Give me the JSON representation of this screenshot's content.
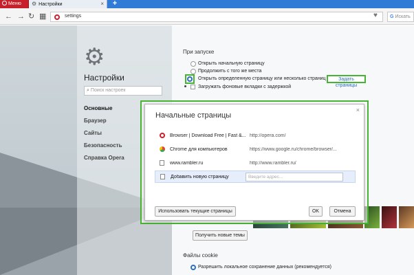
{
  "browser": {
    "menu_label": "Меню",
    "tab_title": "Настройки",
    "tab_close": "×",
    "new_tab": "+",
    "url": "settings",
    "search_engine": "G",
    "search_placeholder": "Искать",
    "nav_back": "←",
    "nav_forward": "→",
    "nav_reload": "↻",
    "grid": "▦",
    "heart": "♥"
  },
  "sidebar": {
    "title": "Настройки",
    "search_placeholder": "Поиск настроек",
    "items": [
      {
        "label": "Основные"
      },
      {
        "label": "Браузер"
      },
      {
        "label": "Сайты"
      },
      {
        "label": "Безопасность"
      },
      {
        "label": "Справка Opera"
      }
    ]
  },
  "startup": {
    "title": "При запуске",
    "options": [
      "Открыть начальную страницу",
      "Продолжить с того же места",
      "Открыть определенную страницу или несколько страниц"
    ],
    "set_pages_link": "Задать страницы",
    "background_tabs": "Загружать фоновые вкладки с задержкой"
  },
  "dialog": {
    "title": "Начальные страницы",
    "close": "×",
    "pages": [
      {
        "name": "Browser | Download Free | Fast &...",
        "url": "http://opera.com/",
        "icon": "opera-icon"
      },
      {
        "name": "Chrome для компьютеров",
        "url": "https://www.google.ru/chrome/browser/...",
        "icon": "chrome-icon"
      },
      {
        "name": "www.rambler.ru",
        "url": "http://www.rambler.ru/",
        "icon": "page-icon"
      }
    ],
    "add_page_label": "Добавить новую страницу",
    "address_placeholder": "Введите адрес...",
    "use_current": "Использовать текущие страницы",
    "ok": "OK",
    "cancel": "Отмена"
  },
  "themes": {
    "get_new": "Получить новые темы"
  },
  "cookies": {
    "title": "Файлы cookie",
    "option": "Разрешить локальное сохранение данных (рекомендуется)"
  }
}
